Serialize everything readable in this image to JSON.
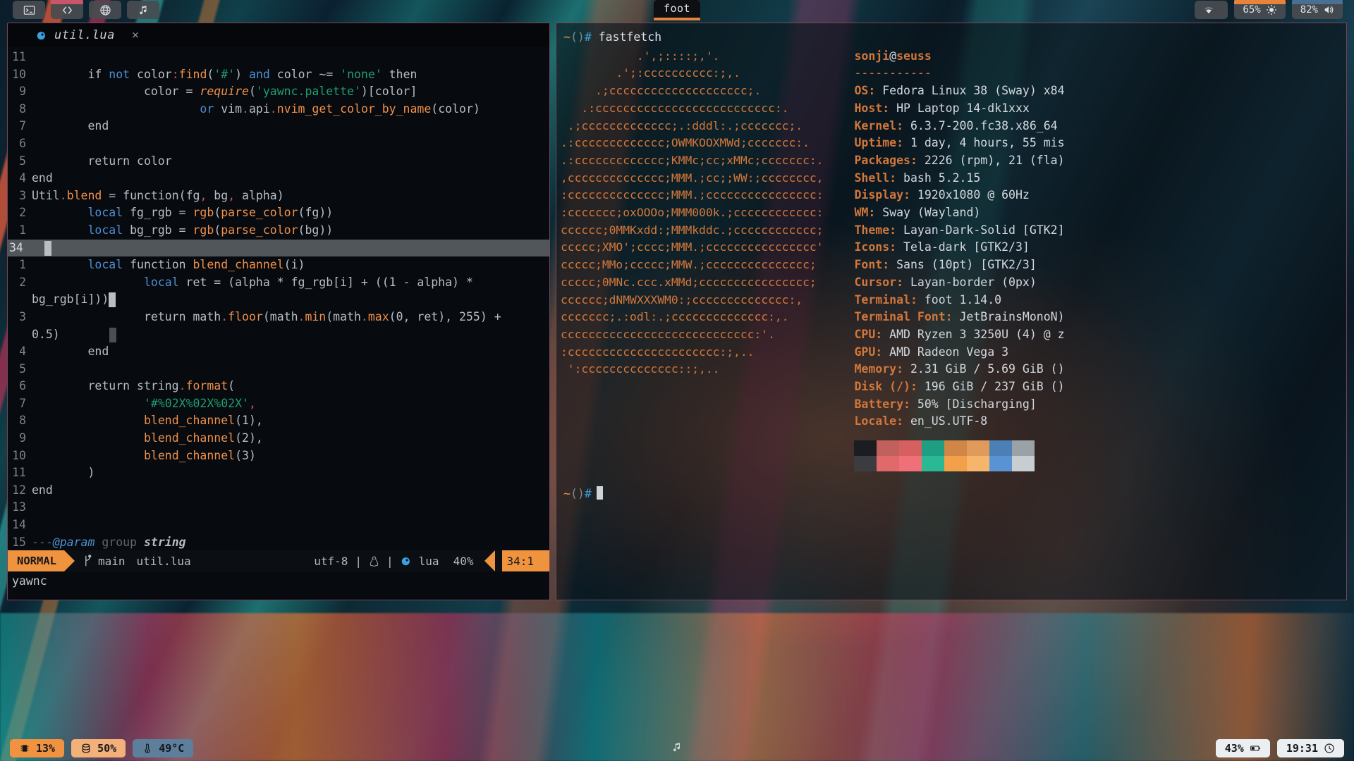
{
  "topbar": {
    "launchers": [
      {
        "name": "terminal-launcher",
        "icon": "terminal-icon",
        "active": false
      },
      {
        "name": "code-launcher",
        "icon": "code-brackets-icon",
        "active": true
      },
      {
        "name": "browser-launcher",
        "icon": "globe-icon",
        "active": false
      },
      {
        "name": "music-launcher",
        "icon": "music-note-icon",
        "active": false
      }
    ],
    "window_title": "foot",
    "tray": {
      "wifi_icon": "wifi-icon",
      "brightness_value": "65%",
      "brightness_icon": "sun-icon",
      "volume_value": "82%",
      "volume_icon": "speaker-icon"
    }
  },
  "editor": {
    "tab": {
      "icon": "lua-moon-icon",
      "filename": "util.lua",
      "close": "×"
    },
    "lines": [
      {
        "num": "11",
        "tokens": []
      },
      {
        "num": "10",
        "tokens": [
          {
            "t": "        ",
            "c": "var"
          },
          {
            "t": "if ",
            "c": "var"
          },
          {
            "t": "not",
            "c": "kw"
          },
          {
            "t": " color",
            "c": "var"
          },
          {
            "t": ":",
            "c": "pun"
          },
          {
            "t": "find",
            "c": "fn"
          },
          {
            "t": "(",
            "c": "var"
          },
          {
            "t": "'#'",
            "c": "str"
          },
          {
            "t": ") ",
            "c": "var"
          },
          {
            "t": "and",
            "c": "kw"
          },
          {
            "t": " color ~= ",
            "c": "var"
          },
          {
            "t": "'none'",
            "c": "str"
          },
          {
            "t": " then",
            "c": "var"
          }
        ]
      },
      {
        "num": "9",
        "tokens": [
          {
            "t": "                color = ",
            "c": "var"
          },
          {
            "t": "require",
            "c": "fni"
          },
          {
            "t": "(",
            "c": "var"
          },
          {
            "t": "'yawnc.palette'",
            "c": "str"
          },
          {
            "t": ")[color]",
            "c": "var"
          }
        ]
      },
      {
        "num": "8",
        "tokens": [
          {
            "t": "                        ",
            "c": "var"
          },
          {
            "t": "or",
            "c": "kw"
          },
          {
            "t": " vim",
            "c": "var"
          },
          {
            "t": ".",
            "c": "pun"
          },
          {
            "t": "api",
            "c": "var"
          },
          {
            "t": ".",
            "c": "pun"
          },
          {
            "t": "nvim_get_color_by_name",
            "c": "fn"
          },
          {
            "t": "(color)",
            "c": "var"
          }
        ]
      },
      {
        "num": "7",
        "tokens": [
          {
            "t": "        end",
            "c": "var"
          }
        ]
      },
      {
        "num": "6",
        "tokens": []
      },
      {
        "num": "5",
        "tokens": [
          {
            "t": "        return color",
            "c": "var"
          }
        ]
      },
      {
        "num": "4",
        "tokens": [
          {
            "t": "end",
            "c": "var"
          }
        ]
      },
      {
        "num": "3",
        "tokens": [
          {
            "t": "Util",
            "c": "var"
          },
          {
            "t": ".",
            "c": "pun"
          },
          {
            "t": "blend",
            "c": "fn"
          },
          {
            "t": " = function(fg",
            "c": "var"
          },
          {
            "t": ",",
            "c": "pun"
          },
          {
            "t": " bg",
            "c": "var"
          },
          {
            "t": ",",
            "c": "pun"
          },
          {
            "t": " alpha)",
            "c": "var"
          }
        ]
      },
      {
        "num": "2",
        "tokens": [
          {
            "t": "        ",
            "c": "var"
          },
          {
            "t": "local",
            "c": "kw"
          },
          {
            "t": " fg_rgb = ",
            "c": "var"
          },
          {
            "t": "rgb",
            "c": "fn"
          },
          {
            "t": "(",
            "c": "var"
          },
          {
            "t": "parse_color",
            "c": "fn"
          },
          {
            "t": "(fg))",
            "c": "var"
          }
        ]
      },
      {
        "num": "1",
        "tokens": [
          {
            "t": "        ",
            "c": "var"
          },
          {
            "t": "local",
            "c": "kw"
          },
          {
            "t": " bg_rgb = ",
            "c": "var"
          },
          {
            "t": "rgb",
            "c": "fn"
          },
          {
            "t": "(",
            "c": "var"
          },
          {
            "t": "parse_color",
            "c": "fn"
          },
          {
            "t": "(bg))",
            "c": "var"
          }
        ]
      },
      {
        "num": "34",
        "current": true,
        "tokens": []
      },
      {
        "num": "1",
        "tokens": [
          {
            "t": "        ",
            "c": "var"
          },
          {
            "t": "local",
            "c": "kw"
          },
          {
            "t": " function ",
            "c": "var"
          },
          {
            "t": "blend_channel",
            "c": "fn"
          },
          {
            "t": "(i)",
            "c": "var"
          }
        ]
      },
      {
        "num": "2",
        "tokens": [
          {
            "t": "                ",
            "c": "var"
          },
          {
            "t": "local",
            "c": "kw"
          },
          {
            "t": " ret = (alpha * fg_rgb[i] + ((",
            "c": "var"
          },
          {
            "t": "1",
            "c": "num"
          },
          {
            "t": " - alpha) *",
            "c": "var"
          }
        ],
        "wrap": [
          {
            "t": "bg_rgb[i]))",
            "c": "var"
          },
          {
            "t": "CURSOR",
            "c": "cursor"
          }
        ]
      },
      {
        "num": "3",
        "tokens": [
          {
            "t": "                return math",
            "c": "var"
          },
          {
            "t": ".",
            "c": "pun"
          },
          {
            "t": "floor",
            "c": "fn"
          },
          {
            "t": "(math",
            "c": "var"
          },
          {
            "t": ".",
            "c": "pun"
          },
          {
            "t": "min",
            "c": "fn"
          },
          {
            "t": "(math",
            "c": "var"
          },
          {
            "t": ".",
            "c": "pun"
          },
          {
            "t": "max",
            "c": "fn"
          },
          {
            "t": "(",
            "c": "var"
          },
          {
            "t": "0",
            "c": "num"
          },
          {
            "t": ", ret), ",
            "c": "var"
          },
          {
            "t": "255",
            "c": "num"
          },
          {
            "t": ") +",
            "c": "var"
          }
        ],
        "wrap": [
          {
            "t": "0.5)",
            "c": "var"
          },
          {
            "t": "MATCHBLK",
            "c": "matchblk"
          }
        ]
      },
      {
        "num": "4",
        "tokens": [
          {
            "t": "        end",
            "c": "var"
          }
        ]
      },
      {
        "num": "5",
        "tokens": []
      },
      {
        "num": "6",
        "tokens": [
          {
            "t": "        return string",
            "c": "var"
          },
          {
            "t": ".",
            "c": "pun"
          },
          {
            "t": "format",
            "c": "fn"
          },
          {
            "t": "(",
            "c": "var"
          }
        ]
      },
      {
        "num": "7",
        "tokens": [
          {
            "t": "                ",
            "c": "var"
          },
          {
            "t": "'#%02X%02X%02X'",
            "c": "str"
          },
          {
            "t": ",",
            "c": "pun"
          }
        ]
      },
      {
        "num": "8",
        "tokens": [
          {
            "t": "                ",
            "c": "var"
          },
          {
            "t": "blend_channel",
            "c": "fn"
          },
          {
            "t": "(",
            "c": "var"
          },
          {
            "t": "1",
            "c": "num"
          },
          {
            "t": "),",
            "c": "var"
          }
        ]
      },
      {
        "num": "9",
        "tokens": [
          {
            "t": "                ",
            "c": "var"
          },
          {
            "t": "blend_channel",
            "c": "fn"
          },
          {
            "t": "(",
            "c": "var"
          },
          {
            "t": "2",
            "c": "num"
          },
          {
            "t": "),",
            "c": "var"
          }
        ]
      },
      {
        "num": "10",
        "tokens": [
          {
            "t": "                ",
            "c": "var"
          },
          {
            "t": "blend_channel",
            "c": "fn"
          },
          {
            "t": "(",
            "c": "var"
          },
          {
            "t": "3",
            "c": "num"
          },
          {
            "t": ")",
            "c": "var"
          }
        ]
      },
      {
        "num": "11",
        "tokens": [
          {
            "t": "        )",
            "c": "var"
          }
        ]
      },
      {
        "num": "12",
        "tokens": [
          {
            "t": "end",
            "c": "var"
          }
        ]
      },
      {
        "num": "13",
        "tokens": []
      },
      {
        "num": "14",
        "tokens": []
      },
      {
        "num": "15",
        "tokens": [
          {
            "t": "---",
            "c": "cmt"
          },
          {
            "t": "@param",
            "c": "param"
          },
          {
            "t": " group ",
            "c": "cmt"
          },
          {
            "t": "string",
            "c": "ptype"
          }
        ]
      }
    ],
    "statusline": {
      "mode": "NORMAL",
      "branch_icon": "git-branch-icon",
      "branch": "main",
      "filename": "util.lua",
      "encoding": "utf-8",
      "sep": "|",
      "os_icon": "linux-penguin-icon",
      "lang_icon": "lua-moon-icon",
      "filetype": "lua",
      "scroll": "40%",
      "position": "34:1"
    },
    "cmdline": "yawnc"
  },
  "terminal": {
    "prompt_tilde": "~",
    "prompt_paren": "()",
    "prompt_hash": "#",
    "command": "fastfetch",
    "ascii_art": "           .',;::::;,'.\n        .';:cccccccccc:;,.\n     .;cccccccccccccccccccc;.\n   .:cccccccccccccccccccccccccc:.\n .;ccccccccccccc;.:dddl:.;ccccccc;.\n.:ccccccccccccc;OWMKOOXMWd;ccccccc:.\n.:ccccccccccccc;KMMc;cc;xMMc;ccccccc:.\n,cccccccccccccc;MMM.;cc;;WW:;cccccccc,\n:cccccccccccccc;MMM.;cccccccccccccccc:\n:ccccccc;oxOOOo;MMM000k.;cccccccccccc:\ncccccc;0MMKxdd:;MMMkddc.;cccccccccccc;\nccccc;XMO';cccc;MMM.;cccccccccccccccc'\nccccc;MMo;ccccc;MMW.;ccccccccccccccc;\nccccc;0MNc.ccc.xMMd;cccccccccccccccc;\ncccccc;dNMWXXXWM0:;cccccccccccccc:,\nccccccc;.:odl:.;cccccccccccccc:,.\ncccccccccccccccccccccccccccc:'.\n:cccccccccccccccccccccc:;,..\n ':cccccccccccccc::;,..",
    "user_host": {
      "user": "sonji",
      "at": "@",
      "host": "seuss"
    },
    "rule": "-----------",
    "info": [
      {
        "label": "OS",
        "value": "Fedora Linux 38 (Sway) x84"
      },
      {
        "label": "Host",
        "value": "HP Laptop 14-dk1xxx"
      },
      {
        "label": "Kernel",
        "value": "6.3.7-200.fc38.x86_64"
      },
      {
        "label": "Uptime",
        "value": "1 day, 4 hours, 55 mis"
      },
      {
        "label": "Packages",
        "value": "2226 (rpm), 21 (fla)"
      },
      {
        "label": "Shell",
        "value": "bash 5.2.15"
      },
      {
        "label": "Display",
        "value": "1920x1080 @ 60Hz"
      },
      {
        "label": "WM",
        "value": "Sway (Wayland)"
      },
      {
        "label": "Theme",
        "value": "Layan-Dark-Solid [GTK2]"
      },
      {
        "label": "Icons",
        "value": "Tela-dark [GTK2/3]"
      },
      {
        "label": "Font",
        "value": "Sans (10pt) [GTK2/3]"
      },
      {
        "label": "Cursor",
        "value": "Layan-border (0px)"
      },
      {
        "label": "Terminal",
        "value": "foot 1.14.0"
      },
      {
        "label": "Terminal Font",
        "value": "JetBrainsMonoN)"
      },
      {
        "label": "CPU",
        "value": "AMD Ryzen 3 3250U (4) @ z"
      },
      {
        "label": "GPU",
        "value": "AMD Radeon Vega 3"
      },
      {
        "label": "Memory",
        "value": "2.31 GiB / 5.69 GiB ()"
      },
      {
        "label": "Disk (/)",
        "value": "196 GiB / 237 GiB ()"
      },
      {
        "label": "Battery",
        "value": "50% [Discharging]"
      },
      {
        "label": "Locale",
        "value": "en_US.UTF-8"
      }
    ],
    "palette_row1": [
      "#1b1d20",
      "#c2605e",
      "#d6605f",
      "#1f9e84",
      "#cf8646",
      "#e09a5a",
      "#4c7fb5",
      "#9aa2a8"
    ],
    "palette_row2": [
      "#3a3c40",
      "#e06a6a",
      "#f0707a",
      "#2bb894",
      "#f2a04a",
      "#f5b56a",
      "#5a93d4",
      "#c8cdd2"
    ]
  },
  "bottombar": {
    "cpu": {
      "icon": "chip-icon",
      "value": "13%"
    },
    "memory": {
      "icon": "database-icon",
      "value": "50%"
    },
    "temperature": {
      "icon": "thermometer-icon",
      "value": "49°C"
    },
    "music_icon": "music-note-icon",
    "battery": {
      "icon": "battery-icon",
      "value": "43%"
    },
    "clock": {
      "icon": "clock-icon",
      "value": "19:31"
    }
  }
}
